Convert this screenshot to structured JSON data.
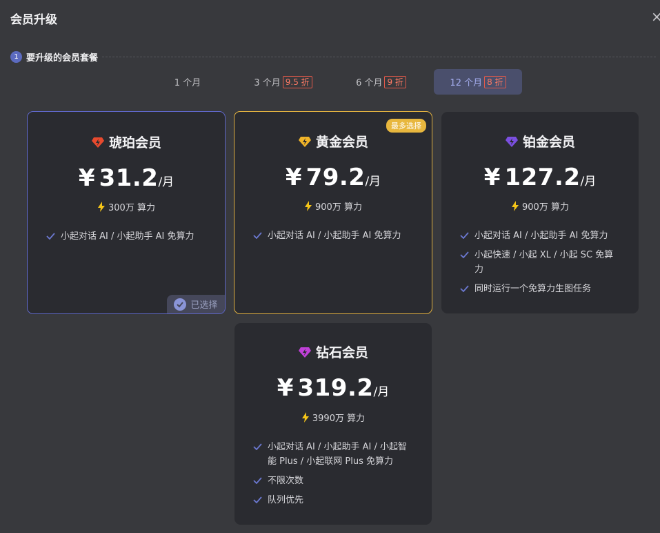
{
  "dialog": {
    "title": "会员升级",
    "close_symbol": "×"
  },
  "section": {
    "step": "1",
    "label": "要升级的会员套餐"
  },
  "tabs": [
    {
      "label": "1 个月",
      "discount": ""
    },
    {
      "label": "3 个月",
      "discount": "9.5 折"
    },
    {
      "label": "6 个月",
      "discount": "9 折"
    },
    {
      "label": "12 个月",
      "discount": "8 折"
    }
  ],
  "selected_tab": "12 个月",
  "plans": [
    {
      "name": "琥珀会员",
      "currency": "¥",
      "price": "31.2",
      "unit": "/月",
      "credits": "300万 算力",
      "icon": "amber-gem-icon",
      "icon_color": "#e84a2e",
      "features": [
        "小起对话 AI / 小起助手 AI 免算力"
      ],
      "status": "已选择"
    },
    {
      "name": "黄金会员",
      "currency": "¥",
      "price": "79.2",
      "unit": "/月",
      "credits": "900万 算力",
      "icon": "gold-gem-icon",
      "icon_color": "#f0b429",
      "badge": "最多选择",
      "features": [
        "小起对话 AI / 小起助手 AI 免算力"
      ]
    },
    {
      "name": "铂金会员",
      "currency": "¥",
      "price": "127.2",
      "unit": "/月",
      "credits": "900万 算力",
      "icon": "platinum-gem-icon",
      "icon_color": "#7b4fe0",
      "features": [
        "小起对话 AI / 小起助手 AI 免算力",
        "小起快速 / 小起 XL / 小起 SC 免算力",
        "同时运行一个免算力生图任务"
      ]
    },
    {
      "name": "钻石会员",
      "currency": "¥",
      "price": "319.2",
      "unit": "/月",
      "credits": "3990万 算力",
      "icon": "diamond-gem-icon",
      "icon_color": "#c040d8",
      "features": [
        "小起对话 AI / 小起助手 AI / 小起智能 Plus / 小起联网 Plus 免算力",
        "不限次数",
        "队列优先"
      ]
    }
  ],
  "colors": {
    "accent": "#5f67c8",
    "gold_border": "#e0b040",
    "check": "#6b78d0",
    "bolt": "#f5c518",
    "discount": "#ff7a64"
  }
}
